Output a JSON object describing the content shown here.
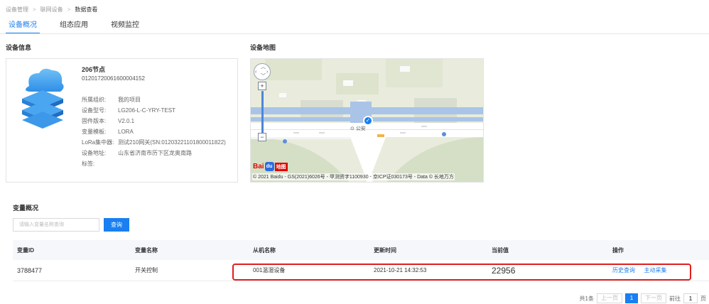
{
  "breadcrumb": {
    "items": [
      "设备管理",
      "联网设备",
      "数据查看"
    ],
    "separator": ">"
  },
  "tabs": [
    {
      "label": "设备概况",
      "active": true
    },
    {
      "label": "组态应用",
      "active": false
    },
    {
      "label": "视频监控",
      "active": false
    }
  ],
  "device_info": {
    "section_title": "设备信息",
    "name": "206节点",
    "serial": "01201720061600004152",
    "fields": [
      {
        "label": "所属组织:",
        "value": "我的项目"
      },
      {
        "label": "设备型号:",
        "value": "LG206-L-C-YRY-TEST"
      },
      {
        "label": "固件版本:",
        "value": "V2.0.1"
      },
      {
        "label": "变量模板:",
        "value": "LORA"
      },
      {
        "label": "LoRa集中器:",
        "value": "测试210网关(SN:01203221101800011822)"
      },
      {
        "label": "设备地址:",
        "value": "山东省济南市历下区龙奥南路"
      },
      {
        "label": "标签:",
        "value": ""
      }
    ],
    "icon": "stacked-cloud-server-icon"
  },
  "device_map": {
    "section_title": "设备地图",
    "copyright": "© 2021 Baidu - GS(2021)6026号 - 甲测资字1100930 - 京ICP证030173号 - Data © 长地万方",
    "logo_text": "Bai",
    "logo_paw": "du",
    "logo_map": "地图",
    "poi": "公安",
    "zoom_in": "+",
    "zoom_out": "−",
    "marker": "✓"
  },
  "variables": {
    "section_title": "变量概况",
    "search_placeholder": "请输入变量名称查询",
    "query_button": "查询",
    "columns": [
      "变量ID",
      "变量名称",
      "从机名称",
      "更新时间",
      "当前值",
      "操作"
    ],
    "rows": [
      {
        "id": "3788477",
        "name": "开关控制",
        "slave": "001温湿设备",
        "updated": "2021-10-21 14:32:53",
        "value": "22956",
        "actions": [
          "历史查询",
          "主动采集"
        ]
      }
    ]
  },
  "pagination": {
    "total": "共1条",
    "prev": "上一页",
    "current_page": "1",
    "next": "下一页",
    "goto_label": "前往",
    "goto_value": "1",
    "page_unit": "页"
  },
  "colors": {
    "accent": "#1a7ff0",
    "highlight": "#e01e1e"
  }
}
